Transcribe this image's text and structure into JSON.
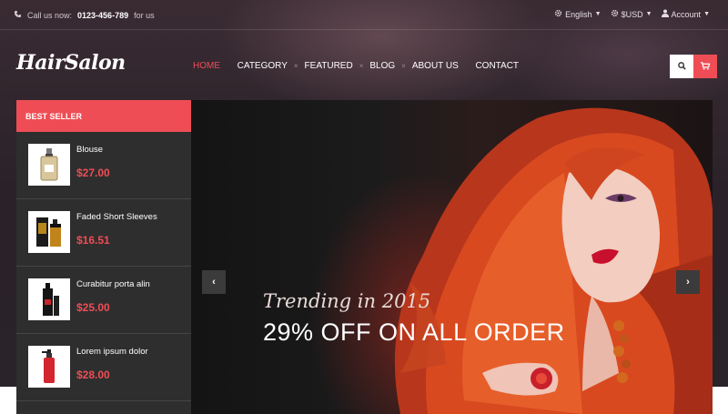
{
  "topbar": {
    "call_label": "Call us now:",
    "phone": "0123-456-789",
    "call_suffix": "for us",
    "language": "English",
    "currency": "$USD",
    "account": "Account"
  },
  "logo": "HairSalon",
  "nav": {
    "items": [
      "HOME",
      "CATEGORY",
      "FEATURED",
      "BLOG",
      "ABOUT US",
      "CONTACT"
    ],
    "active": "HOME",
    "accent": "#ef4d55"
  },
  "sidebar": {
    "title": "BEST SELLER",
    "products": [
      {
        "name": "Blouse",
        "price": "$27.00"
      },
      {
        "name": "Faded Short Sleeves",
        "price": "$16.51"
      },
      {
        "name": "Curabitur porta alin",
        "price": "$25.00"
      },
      {
        "name": "Lorem ipsum dolor",
        "price": "$28.00"
      }
    ]
  },
  "slider": {
    "subtitle": "Trending in 2015",
    "title": "29% OFF ON ALL ORDER"
  },
  "icons": {
    "phone": "phone-icon",
    "language": "gear-icon",
    "currency": "gear-icon",
    "account": "user-icon",
    "search": "search-icon",
    "cart": "cart-icon"
  }
}
